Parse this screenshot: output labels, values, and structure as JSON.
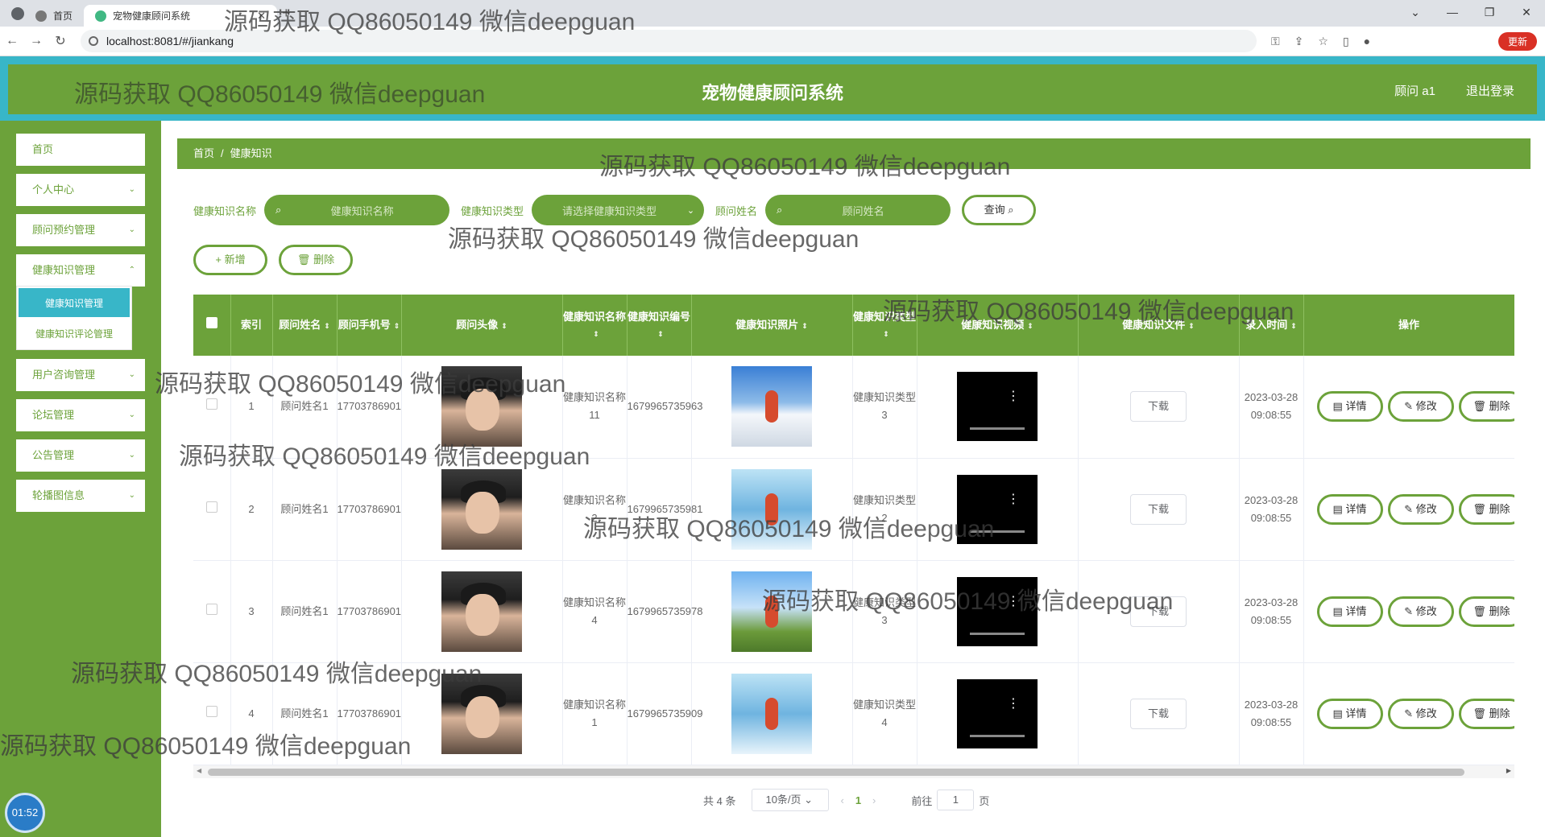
{
  "browser": {
    "tab_title": "宠物健康顾问系统",
    "tab_second": "首页",
    "url": "localhost:8081/#/jiankang",
    "update_label": "更新",
    "window_controls": [
      "⌄",
      "—",
      "❐",
      "✕"
    ]
  },
  "header": {
    "title": "宠物健康顾问系统",
    "user_label": "顾问 a1",
    "logout_label": "退出登录"
  },
  "sidebar": {
    "items": [
      {
        "label": "首页"
      },
      {
        "label": "个人中心"
      },
      {
        "label": "顾问预约管理"
      },
      {
        "label": "健康知识管理"
      },
      {
        "label": "用户咨询管理"
      },
      {
        "label": "论坛管理"
      },
      {
        "label": "公告管理"
      },
      {
        "label": "轮播图信息"
      }
    ],
    "submenu": [
      "健康知识管理",
      "健康知识评论管理"
    ]
  },
  "clock": "01:52",
  "breadcrumb": {
    "home": "首页",
    "sep": "/",
    "current": "健康知识"
  },
  "search": {
    "name_label": "健康知识名称",
    "name_placeholder": "健康知识名称",
    "type_label": "健康知识类型",
    "type_placeholder": "请选择健康知识类型",
    "advisor_label": "顾问姓名",
    "advisor_placeholder": "顾问姓名",
    "query_label": "查询"
  },
  "actions": {
    "add_label": "+ 新增",
    "delete_label": "删除"
  },
  "table": {
    "headers": [
      "索引",
      "顾问姓名",
      "顾问手机号",
      "顾问头像",
      "健康知识名称",
      "健康知识编号",
      "健康知识照片",
      "健康知识类型",
      "健康知识视频",
      "健康知识文件",
      "录入时间",
      "操作"
    ],
    "rows": [
      {
        "index": "1",
        "advisor": "顾问姓名1",
        "phone": "17703786901",
        "name": "健康知识名称11",
        "code": "1679965735963",
        "type": "健康知识类型3",
        "photo": "ski",
        "file": "下载",
        "time": "2023-03-28 09:08:55"
      },
      {
        "index": "2",
        "advisor": "顾问姓名1",
        "phone": "17703786901",
        "name": "健康知识名称2",
        "code": "1679965735981",
        "type": "健康知识类型2",
        "photo": "run",
        "file": "下载",
        "time": "2023-03-28 09:08:55"
      },
      {
        "index": "3",
        "advisor": "顾问姓名1",
        "phone": "17703786901",
        "name": "健康知识名称4",
        "code": "1679965735978",
        "type": "健康知识类型3",
        "photo": "bike",
        "file": "下载",
        "time": "2023-03-28 09:08:55"
      },
      {
        "index": "4",
        "advisor": "顾问姓名1",
        "phone": "17703786901",
        "name": "健康知识名称1",
        "code": "1679965735909",
        "type": "健康知识类型4",
        "photo": "run",
        "file": "下载",
        "time": "2023-03-28 09:08:55"
      }
    ],
    "ops": {
      "detail": "详情",
      "edit": "修改",
      "delete": "删除"
    }
  },
  "pagination": {
    "total": "共 4 条",
    "page_size": "10条/页",
    "current": "1",
    "goto_prefix": "前往",
    "goto_value": "1",
    "goto_suffix": "页"
  },
  "watermark": "源码获取 QQ86050149 微信deepguan",
  "colors": {
    "primary": "#6ca23a",
    "accent": "#38b6c8"
  }
}
